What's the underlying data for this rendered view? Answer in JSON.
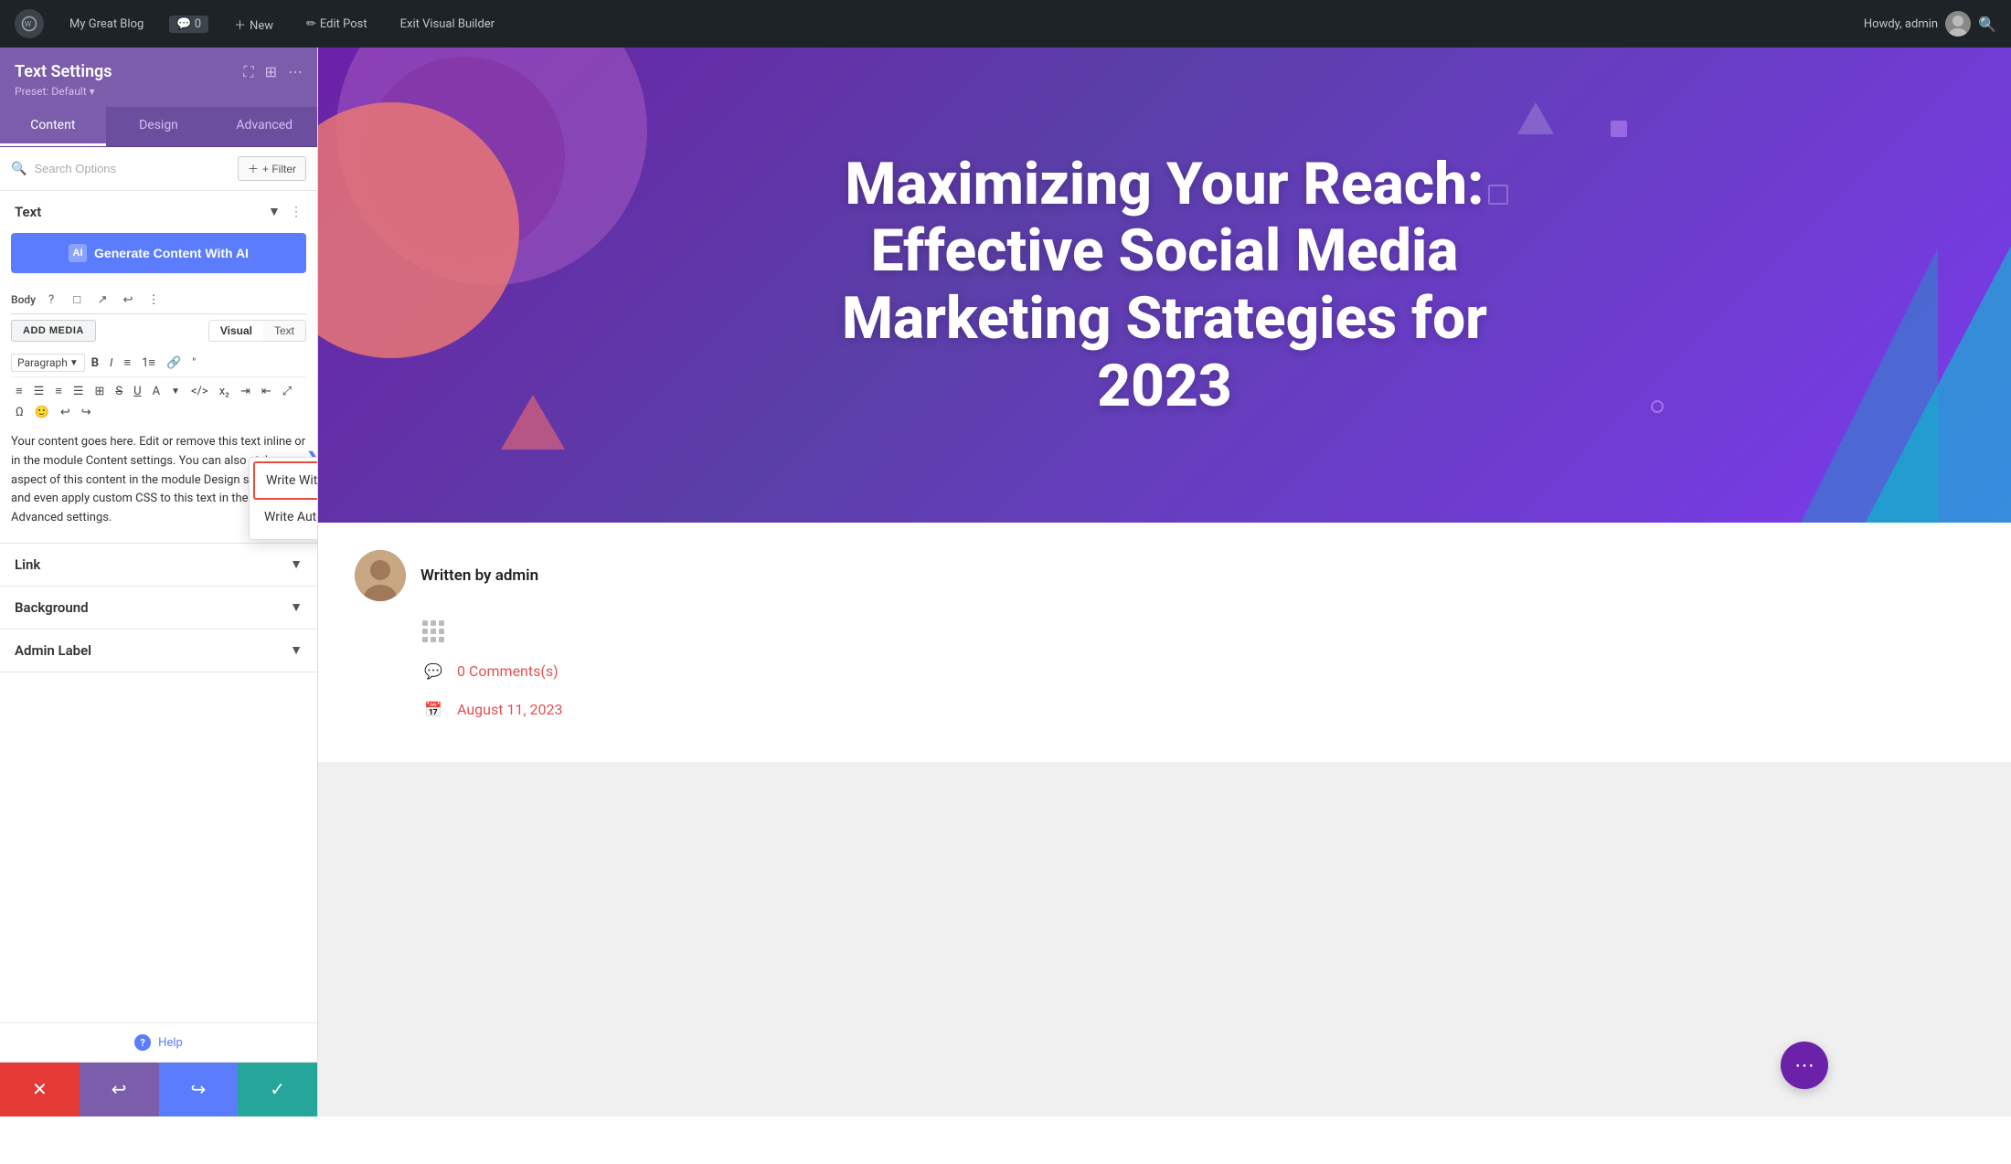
{
  "admin_bar": {
    "site_name": "My Great Blog",
    "comments_count": "0",
    "new_label": "New",
    "edit_post_label": "Edit Post",
    "exit_builder_label": "Exit Visual Builder",
    "howdy_text": "Howdy, admin"
  },
  "panel": {
    "title": "Text Settings",
    "preset": "Preset: Default ▾",
    "tabs": [
      "Content",
      "Design",
      "Advanced"
    ],
    "active_tab": "Content",
    "search_placeholder": "Search Options",
    "filter_label": "+ Filter"
  },
  "text_section": {
    "title": "Text",
    "ai_button_label": "Generate Content With AI",
    "ai_badge": "AI",
    "editor": {
      "body_label": "Body",
      "visual_tab": "Visual",
      "text_tab": "Text",
      "add_media_label": "ADD MEDIA",
      "paragraph_label": "Paragraph",
      "content": "Your content goes here. Edit or remove this text inline or in the module Content settings. You can also style every aspect of this content in the module Design settings, and even apply custom CSS to this text in the module Advanced settings."
    },
    "context_menu": {
      "write_with_ai": "Write With AI",
      "write_automatically": "Write Automatically"
    }
  },
  "link_section": {
    "title": "Link"
  },
  "background_section": {
    "title": "Background"
  },
  "admin_label_section": {
    "title": "Admin Label"
  },
  "footer": {
    "help_label": "Help"
  },
  "bottom_bar": {
    "cancel": "✕",
    "undo": "↩",
    "redo": "↪",
    "save": "✓"
  },
  "hero": {
    "title": "Maximizing Your Reach: Effective Social Media Marketing Strategies for 2023"
  },
  "post_meta": {
    "author": "Written by admin",
    "comments": "0 Comments(s)",
    "date": "August 11, 2023"
  }
}
